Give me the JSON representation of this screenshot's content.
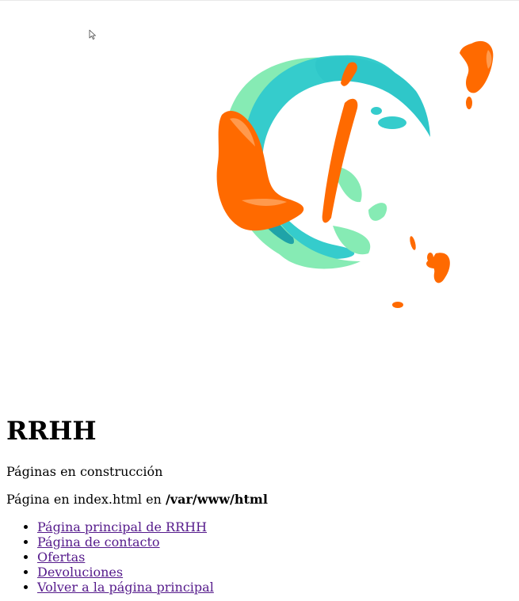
{
  "page": {
    "title": "RRHH",
    "subtitle": "Páginas en construcción",
    "path_text": "Página en index.html en",
    "path_value": "/var/www/html"
  },
  "links": [
    {
      "label": "Página principal de RRHH"
    },
    {
      "label": "Página de contacto"
    },
    {
      "label": "Ofertas"
    },
    {
      "label": "Devoluciones"
    },
    {
      "label": "Volver a la página principal"
    }
  ],
  "colors": {
    "visited_link": "#551a8b",
    "logo_teal": "#35cccc",
    "logo_mint": "#86ebb4",
    "logo_orange": "#ff6a00"
  },
  "icons": {
    "cursor": "mouse-pointer-icon",
    "logo": "paint-splash-logo"
  }
}
